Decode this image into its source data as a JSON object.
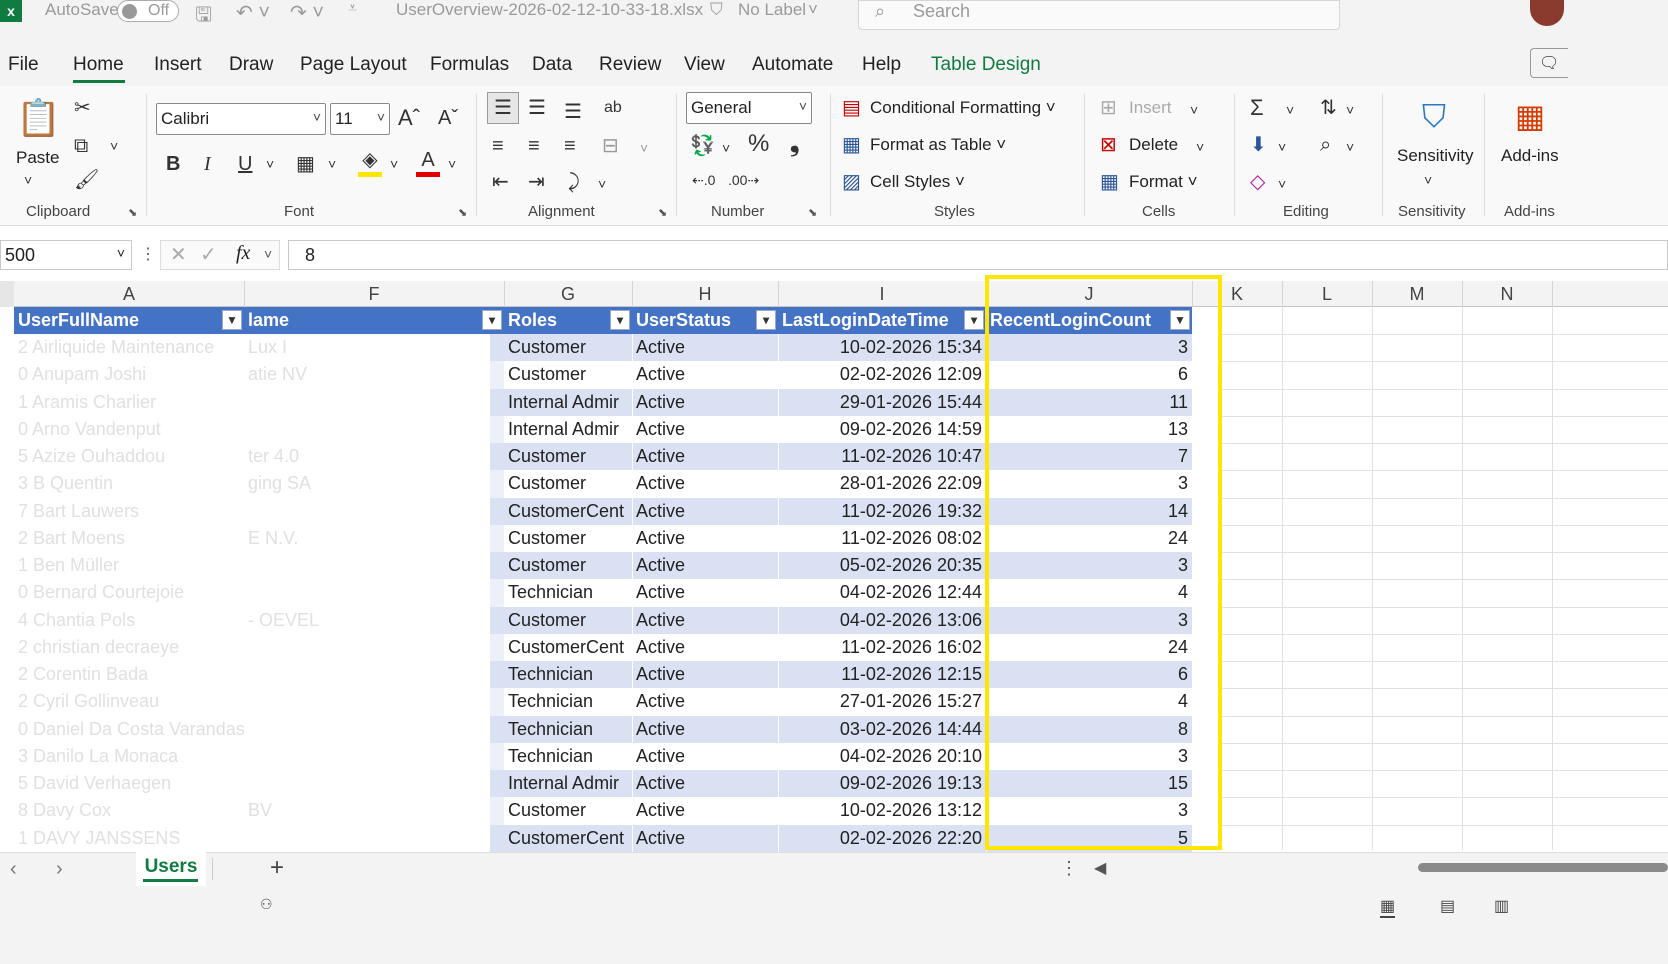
{
  "titlebar": {
    "autosave_label": "AutoSave",
    "toggle_label": "Off",
    "filename": "UserOverview-2026-02-12-10-33-18.xlsx",
    "label_status": "No Label",
    "search_placeholder": "Search"
  },
  "menu": [
    "File",
    "Home",
    "Insert",
    "Draw",
    "Page Layout",
    "Formulas",
    "Data",
    "Review",
    "View",
    "Automate",
    "Help",
    "Table Design"
  ],
  "ribbon": {
    "clipboard": {
      "paste": "Paste",
      "label": "Clipboard"
    },
    "font": {
      "name": "Calibri",
      "size": "11",
      "label": "Font",
      "bold": "B",
      "italic": "I",
      "underline": "U"
    },
    "alignment": {
      "label": "Alignment"
    },
    "number": {
      "format": "General",
      "label": "Number",
      "percent": "%"
    },
    "styles": {
      "conditional": "Conditional Formatting",
      "format_table": "Format as Table",
      "cell_styles": "Cell Styles",
      "label": "Styles"
    },
    "cells": {
      "insert": "Insert",
      "delete": "Delete",
      "format": "Format",
      "label": "Cells"
    },
    "editing": {
      "label": "Editing"
    },
    "sensitivity": {
      "button": "Sensitivity",
      "label": "Sensitivity"
    },
    "addins": {
      "button": "Add-ins",
      "label": "Add-ins"
    }
  },
  "formula_bar": {
    "name_box": "500",
    "fx": "fx",
    "value": "8"
  },
  "columns": [
    "A",
    "F",
    "G",
    "H",
    "I",
    "J",
    "K",
    "L",
    "M",
    "N"
  ],
  "table": {
    "headers": {
      "a": "UserFullName",
      "f": "lame",
      "g": "Roles",
      "h": "UserStatus",
      "i": "LastLoginDateTime",
      "j": "RecentLoginCount"
    },
    "rows": [
      {
        "a": "2 Airliquide Maintenance",
        "f": "Lux I",
        "g": "Customer",
        "h": "Active",
        "i": "10-02-2026 15:34",
        "j": "3"
      },
      {
        "a": "0 Anupam Joshi",
        "f": "atie NV",
        "g": "Customer",
        "h": "Active",
        "i": "02-02-2026 12:09",
        "j": "6"
      },
      {
        "a": "1 Aramis Charlier",
        "f": "",
        "g": "Internal Admir",
        "h": "Active",
        "i": "29-01-2026 15:44",
        "j": "11"
      },
      {
        "a": "0 Arno Vandenput",
        "f": "",
        "g": "Internal Admir",
        "h": "Active",
        "i": "09-02-2026 14:59",
        "j": "13"
      },
      {
        "a": "5 Azize Ouhaddou",
        "f": "ter 4.0",
        "g": "Customer",
        "h": "Active",
        "i": "11-02-2026 10:47",
        "j": "7"
      },
      {
        "a": "3 B Quentin",
        "f": "ging SA",
        "g": "Customer",
        "h": "Active",
        "i": "28-01-2026 22:09",
        "j": "3"
      },
      {
        "a": "7 Bart Lauwers",
        "f": "",
        "g": "CustomerCent",
        "h": "Active",
        "i": "11-02-2026 19:32",
        "j": "14"
      },
      {
        "a": "2 Bart Moens",
        "f": "E N.V.",
        "g": "Customer",
        "h": "Active",
        "i": "11-02-2026 08:02",
        "j": "24"
      },
      {
        "a": "1 Ben Müller",
        "f": "",
        "g": "Customer",
        "h": "Active",
        "i": "05-02-2026 20:35",
        "j": "3"
      },
      {
        "a": "0 Bernard Courtejoie",
        "f": "",
        "g": "Technician",
        "h": "Active",
        "i": "04-02-2026 12:44",
        "j": "4"
      },
      {
        "a": "4 Chantia Pols",
        "f": "- OEVEL",
        "g": "Customer",
        "h": "Active",
        "i": "04-02-2026 13:06",
        "j": "3"
      },
      {
        "a": "2 christian decraeye",
        "f": "",
        "g": "CustomerCent",
        "h": "Active",
        "i": "11-02-2026 16:02",
        "j": "24"
      },
      {
        "a": "2 Corentin Bada",
        "f": "",
        "g": "Technician",
        "h": "Active",
        "i": "11-02-2026 12:15",
        "j": "6"
      },
      {
        "a": "2 Cyril Gollinveau",
        "f": "",
        "g": "Technician",
        "h": "Active",
        "i": "27-01-2026 15:27",
        "j": "4"
      },
      {
        "a": "0 Daniel Da Costa Varandas",
        "f": "",
        "g": "Technician",
        "h": "Active",
        "i": "03-02-2026 14:44",
        "j": "8"
      },
      {
        "a": "3 Danilo La Monaca",
        "f": "",
        "g": "Technician",
        "h": "Active",
        "i": "04-02-2026 20:10",
        "j": "3"
      },
      {
        "a": "5 David Verhaegen",
        "f": "",
        "g": "Internal Admir",
        "h": "Active",
        "i": "09-02-2026 19:13",
        "j": "15"
      },
      {
        "a": "8 Davy Cox",
        "f": "BV",
        "g": "Customer",
        "h": "Active",
        "i": "10-02-2026 13:12",
        "j": "3"
      },
      {
        "a": "1 DAVY JANSSENS",
        "f": "",
        "g": "CustomerCent",
        "h": "Active",
        "i": "02-02-2026 22:20",
        "j": "5"
      }
    ]
  },
  "sheet_tabs": {
    "active": "Users",
    "add": "+"
  },
  "colors": {
    "excel_green": "#107c41",
    "table_header": "#4472c4",
    "band": "#d9e1f2",
    "highlight": "#ffe600"
  }
}
